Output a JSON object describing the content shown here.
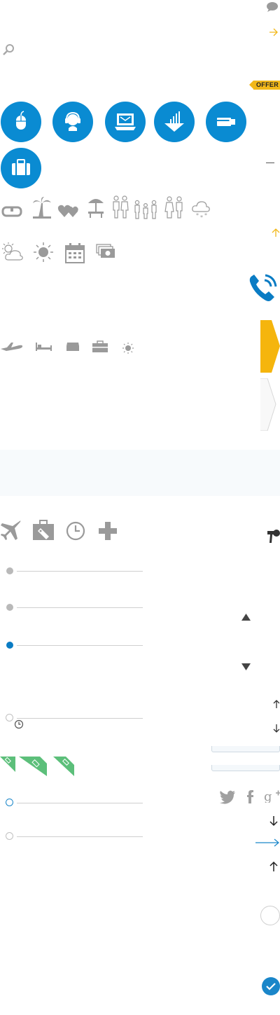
{
  "badges": {
    "offer": "OFFER"
  },
  "colors": {
    "blue": "#0a8bd2",
    "gray_icon": "#9a9a9a",
    "accent_yellow": "#f2b81a",
    "tag_green": "#5cbf7a"
  },
  "icons": {
    "circle_buttons": [
      "mouse-icon",
      "headset-support-icon",
      "laptop-email-icon",
      "chart-growth-icon",
      "card-payment-icon",
      "suitcase-icon"
    ],
    "leisure_row": [
      "snorkel-mask-icon",
      "palm-tree-icon",
      "hearts-icon",
      "beach-umbrella-icon",
      "family-icon",
      "family-children-icon",
      "couple-icon",
      "snow-cloud-icon"
    ],
    "weather_row": [
      "partly-sunny-icon",
      "sun-icon",
      "calendar-icon",
      "money-icon"
    ],
    "travel_row": [
      "airplane-icon",
      "bed-icon",
      "drawer-icon",
      "first-aid-kit-icon",
      "small-sun-icon"
    ],
    "service_row": [
      "plane-icon",
      "luggage-tag-icon",
      "clock-icon",
      "plus-icon"
    ]
  }
}
